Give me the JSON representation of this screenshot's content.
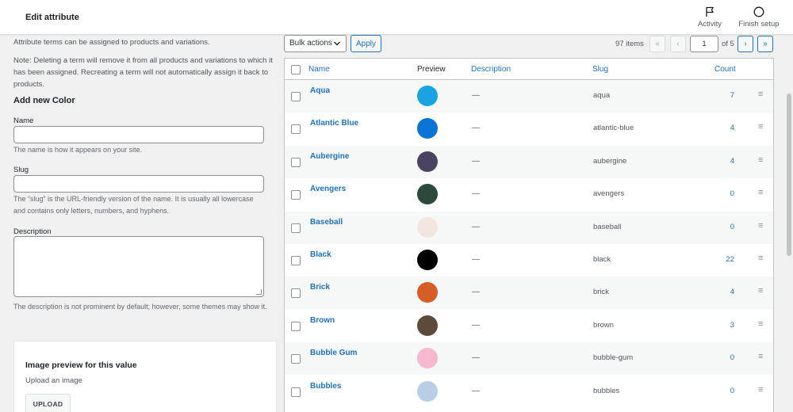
{
  "header": {
    "title": "Edit attribute",
    "activity_label": "Activity",
    "finish_label": "Finish setup"
  },
  "form": {
    "intro": "Attribute terms can be assigned to products and variations.",
    "note": "Note: Deleting a term will remove it from all products and variations to which it has been assigned. Recreating a term will not automatically assign it back to products.",
    "heading": "Add new Color",
    "name_label": "Name",
    "name_value": "",
    "name_help": "The name is how it appears on your site.",
    "slug_label": "Slug",
    "slug_value": "",
    "slug_help": "The “slug” is the URL-friendly version of the name. It is usually all lowercase and contains only letters, numbers, and hyphens.",
    "desc_label": "Description",
    "desc_value": "",
    "desc_help": "The description is not prominent by default; however, some themes may show it.",
    "image_heading": "Image preview for this value",
    "image_sub": "Upload an image",
    "upload_label": "UPLOAD"
  },
  "toolbar": {
    "bulk_label": "Bulk actions",
    "apply_label": "Apply",
    "items": "97 items",
    "first": "«",
    "prev": "‹",
    "page": "1",
    "of": "of 5",
    "next": "›",
    "last": "»"
  },
  "table": {
    "headers": {
      "name": "Name",
      "preview": "Preview",
      "description": "Description",
      "slug": "Slug",
      "count": "Count"
    },
    "rows": [
      {
        "name": "Aqua",
        "color": "#1aa3e0",
        "desc": "—",
        "slug": "aqua",
        "count": "7"
      },
      {
        "name": "Atlantic Blue",
        "color": "#0a73d3",
        "desc": "—",
        "slug": "atlantic-blue",
        "count": "4"
      },
      {
        "name": "Aubergine",
        "color": "#4b4460",
        "desc": "—",
        "slug": "aubergine",
        "count": "4"
      },
      {
        "name": "Avengers",
        "color": "#2b4a3a",
        "desc": "—",
        "slug": "avengers",
        "count": "0"
      },
      {
        "name": "Baseball",
        "color": "#f2e6e0",
        "desc": "—",
        "slug": "baseball",
        "count": "0"
      },
      {
        "name": "Black",
        "color": "#000000",
        "desc": "—",
        "slug": "black",
        "count": "22"
      },
      {
        "name": "Brick",
        "color": "#d55d26",
        "desc": "—",
        "slug": "brick",
        "count": "4"
      },
      {
        "name": "Brown",
        "color": "#5c4b3a",
        "desc": "—",
        "slug": "brown",
        "count": "3"
      },
      {
        "name": "Bubble Gum",
        "color": "#f6b8cf",
        "desc": "—",
        "slug": "bubble-gum",
        "count": "0"
      },
      {
        "name": "Bubbles",
        "color": "#b9cde4",
        "desc": "—",
        "slug": "bubbles",
        "count": "0"
      }
    ]
  }
}
